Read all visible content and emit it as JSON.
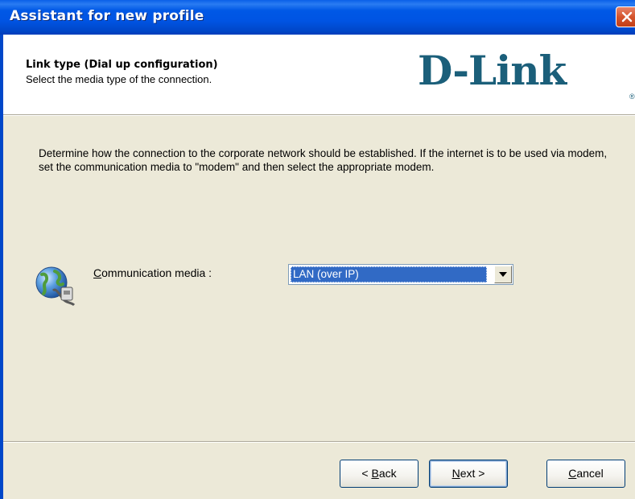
{
  "window": {
    "title": "Assistant for new profile"
  },
  "header": {
    "title": "Link type (Dial up configuration)",
    "subtitle": "Select the media type of the connection.",
    "logo": "D-Link",
    "logo_mark": "®"
  },
  "main": {
    "description": "Determine how the connection to the corporate network should be established. If the internet is to be used via modem, set the communication media to \"modem\" and then select the appropriate modem.",
    "media_label_pre": "",
    "media_label_accel": "C",
    "media_label_post": "ommunication media :",
    "media_select": {
      "selected": "LAN (over IP)"
    }
  },
  "buttons": {
    "back_arrow": "< ",
    "back_accel": "B",
    "back_rest": "ack",
    "next_accel": "N",
    "next_rest": "ext >",
    "cancel_accel": "C",
    "cancel_rest": "ancel"
  },
  "icons": {
    "close": "close-icon",
    "network": "network-globe-icon",
    "dropdown": "chevron-down-icon"
  },
  "colors": {
    "titlebar": "#0054e3",
    "dialog_bg": "#ece9d8",
    "selection": "#316ac5",
    "logo": "#1b5f7a",
    "close": "#d5542c"
  }
}
